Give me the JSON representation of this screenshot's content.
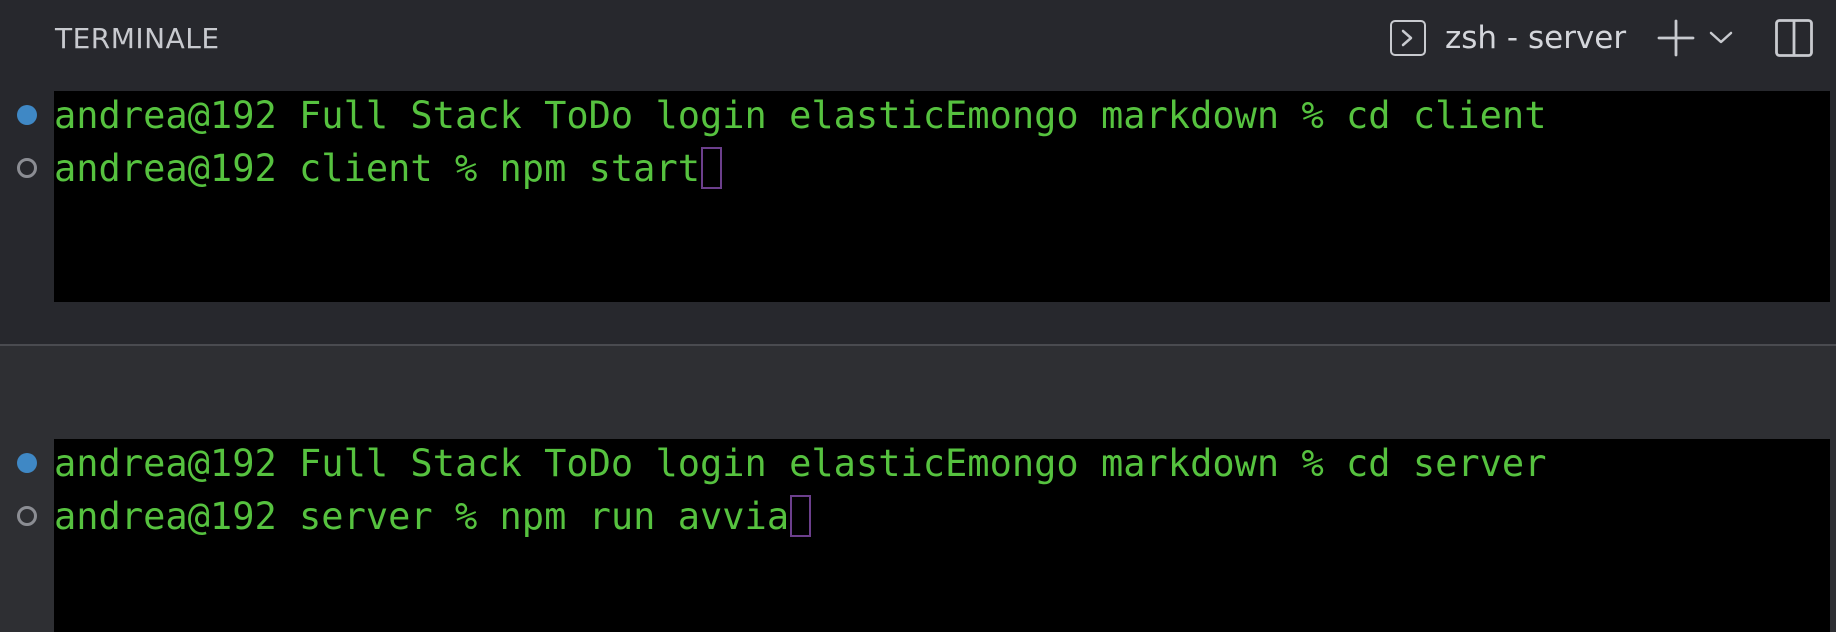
{
  "header": {
    "title": "TERMINALE",
    "active_terminal": "zsh - server",
    "icons": {
      "terminal": "terminal-icon",
      "new": "plus-icon",
      "dropdown": "chevron-down-icon",
      "split": "split-editor-icon"
    }
  },
  "colors": {
    "prompt_green": "#56c23f",
    "dot_active": "#3f88c5",
    "cursor_border": "#6c3f8c"
  },
  "panes": [
    {
      "lines": [
        {
          "status": "success",
          "text": "andrea@192 Full Stack ToDo login elasticEmongo markdown % cd client"
        },
        {
          "status": "pending",
          "text": "andrea@192 client % npm start"
        }
      ]
    },
    {
      "lines": [
        {
          "status": "success",
          "text": "andrea@192 Full Stack ToDo login elasticEmongo markdown % cd server"
        },
        {
          "status": "pending",
          "text": "andrea@192 server % npm run avvia"
        }
      ]
    }
  ]
}
